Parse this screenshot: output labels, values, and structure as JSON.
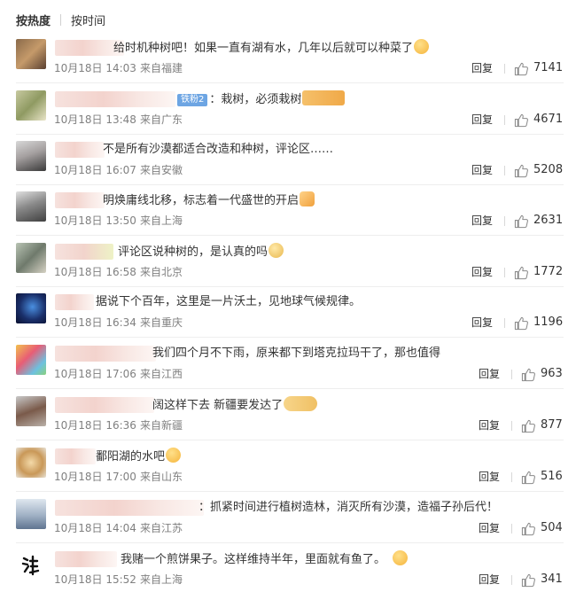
{
  "tabs": [
    {
      "label": "按热度",
      "active": true
    },
    {
      "label": "按时间",
      "active": false
    }
  ],
  "reply_label": "回复",
  "comments": [
    {
      "text": "给时机种树吧！如果一直有湖有水，几年以后就可以种菜了",
      "emoji": "scream-emoji",
      "time": "10月18日 14:03",
      "source": "来自福建",
      "likes": "7141"
    },
    {
      "badge": "铁粉2",
      "text": "：栽树，必须栽树",
      "emoji": "strong-arm-emoji",
      "time": "10月18日 13:48",
      "source": "来自广东",
      "likes": "4671"
    },
    {
      "text": "不是所有沙漠都适合改造和种树，评论区……",
      "time": "10月18日 16:07",
      "source": "来自安徽",
      "likes": "5208"
    },
    {
      "text": "明焕庸线北移，标志着一代盛世的开启",
      "emoji": "thumbs-up-emoji",
      "time": "10月18日 13:50",
      "source": "来自上海",
      "likes": "2631"
    },
    {
      "text": "评论区说种树的，是认真的吗",
      "emoji": "doge-emoji",
      "time": "10月18日 16:58",
      "source": "来自北京",
      "likes": "1772"
    },
    {
      "text": "据说下个百年，这里是一片沃土，见地球气候规律。",
      "time": "10月18日 16:34",
      "source": "来自重庆",
      "likes": "1196"
    },
    {
      "text": "我们四个月不下雨，原来都下到塔克拉玛干了，那也值得",
      "time": "10月18日 17:06",
      "source": "来自江西",
      "likes": "963"
    },
    {
      "text": "阔这样下去 新疆要发达了",
      "emoji": "cat-emoji",
      "time": "10月18日 16:36",
      "source": "来自新疆",
      "likes": "877"
    },
    {
      "text": "鄱阳湖的水吧",
      "emoji": "grin-emoji",
      "time": "10月18日 17:00",
      "source": "来自山东",
      "likes": "516"
    },
    {
      "text": "：抓紧时间进行植树造林，消灭所有沙漠，造福子孙后代！",
      "time": "10月18日 14:04",
      "source": "来自江苏",
      "likes": "504"
    },
    {
      "text": "我赌一个煎饼果子。这样维持半年，里面就有鱼了。",
      "emoji": "tongue-emoji",
      "time": "10月18日 15:52",
      "source": "来自上海",
      "likes": "341"
    }
  ]
}
